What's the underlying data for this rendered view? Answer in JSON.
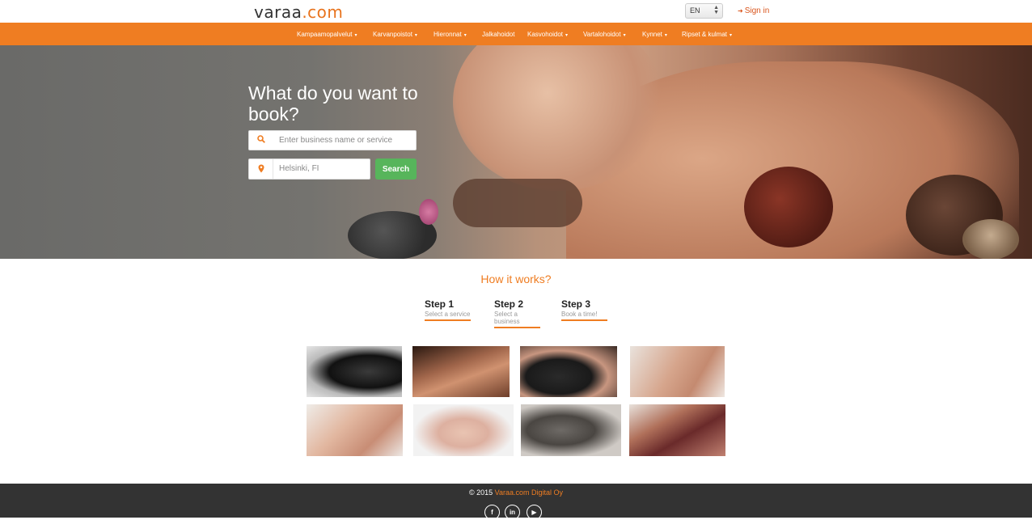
{
  "header": {
    "logo_main": "varaa",
    "logo_suffix": ".com",
    "language": "EN",
    "signin_label": "Sign in"
  },
  "nav": {
    "items": [
      {
        "label": "Kampaamopalvelut",
        "has_dropdown": true
      },
      {
        "label": "Karvanpoistot",
        "has_dropdown": true
      },
      {
        "label": "Hieronnat",
        "has_dropdown": true
      },
      {
        "label": "Jalkahoidot",
        "has_dropdown": false
      },
      {
        "label": "Kasvohoidot",
        "has_dropdown": true
      },
      {
        "label": "Vartalohoidot",
        "has_dropdown": true
      },
      {
        "label": "Kynnet",
        "has_dropdown": true
      },
      {
        "label": "Ripset & kulmat",
        "has_dropdown": true
      }
    ]
  },
  "hero": {
    "title": "What do you want to book?",
    "search_placeholder": "Enter business name or service",
    "location_placeholder": "Helsinki, FI",
    "search_button": "Search"
  },
  "how": {
    "title": "How it works?",
    "steps": [
      {
        "name": "Step 1",
        "desc": "Select a service"
      },
      {
        "name": "Step 2",
        "desc": "Select a business"
      },
      {
        "name": "Step 3",
        "desc": "Book a time!"
      }
    ]
  },
  "gallery": {
    "tiles": [
      "eyelash-extension",
      "back-massage",
      "haircut",
      "leg-massage",
      "foot-massage",
      "manicure",
      "face-mask",
      "leg-waxing"
    ]
  },
  "footer": {
    "copyright": "© 2015",
    "company": "Varaa.com Digital Oy",
    "social": [
      "facebook-icon",
      "linkedin-icon",
      "youtube-icon"
    ]
  },
  "colors": {
    "accent": "#ef7d22",
    "button_green": "#57b55b",
    "footer_bg": "#333333"
  }
}
